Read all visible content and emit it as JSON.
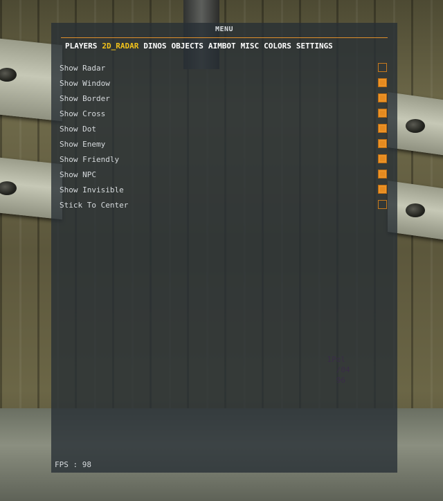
{
  "menu": {
    "title": "MENU",
    "accent_color": "#e0902a",
    "active_tab_color": "#f2c21a",
    "checkbox_color": "#e58a1f"
  },
  "tabs": [
    {
      "label": "PLAYERS",
      "active": false
    },
    {
      "label": "2D_RADAR",
      "active": true
    },
    {
      "label": "DINOS",
      "active": false
    },
    {
      "label": "OBJECTS",
      "active": false
    },
    {
      "label": "AIMBOT",
      "active": false
    },
    {
      "label": "MISC",
      "active": false
    },
    {
      "label": "COLORS",
      "active": false
    },
    {
      "label": "SETTINGS",
      "active": false
    }
  ],
  "options": [
    {
      "label": "Show Radar",
      "checked": false
    },
    {
      "label": "Show Window",
      "checked": true
    },
    {
      "label": "Show Border",
      "checked": true
    },
    {
      "label": "Show Cross",
      "checked": true
    },
    {
      "label": "Show Dot",
      "checked": true
    },
    {
      "label": "Show Enemy",
      "checked": true
    },
    {
      "label": "Show Friendly",
      "checked": true
    },
    {
      "label": "Show NPC",
      "checked": true
    },
    {
      "label": "Show Invisible",
      "checked": true
    },
    {
      "label": "Stick To Center",
      "checked": false
    }
  ],
  "footer": {
    "fps_text": "FPS : 98"
  },
  "overlay": {
    "lines": [
      "                    1Pol",
      "                      /04",
      "                      96"
    ]
  }
}
